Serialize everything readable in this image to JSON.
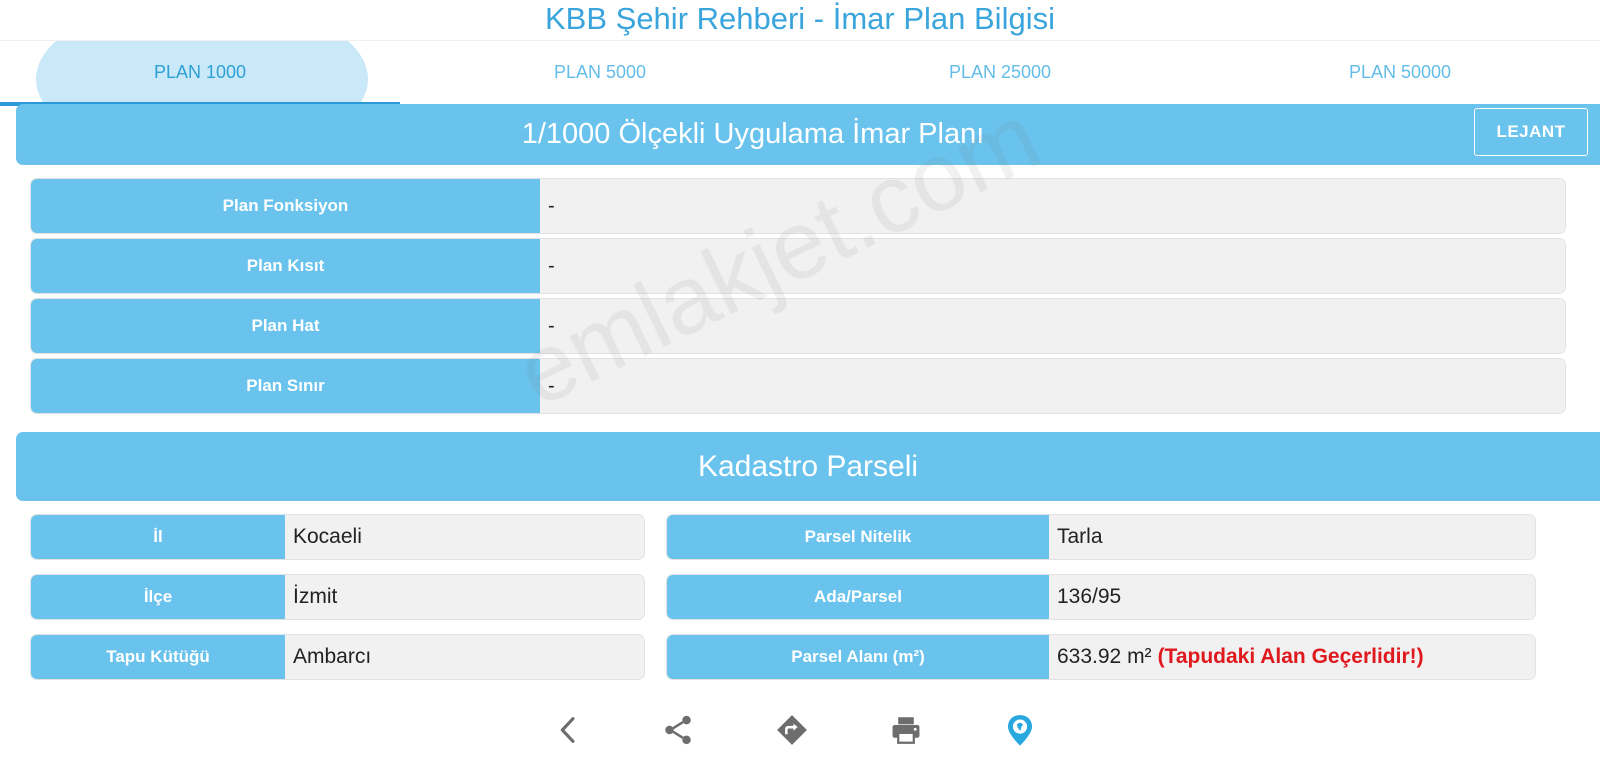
{
  "app": {
    "title": "KBB Şehir Rehberi - İmar Plan Bilgisi"
  },
  "tabs": [
    {
      "label": "PLAN 1000",
      "active": true
    },
    {
      "label": "PLAN 5000",
      "active": false
    },
    {
      "label": "PLAN 25000",
      "active": false
    },
    {
      "label": "PLAN 50000",
      "active": false
    }
  ],
  "plan_section": {
    "title": "1/1000 Ölçekli Uygulama İmar Planı",
    "legend_label": "LEJANT",
    "rows": [
      {
        "label": "Plan Fonksiyon",
        "value": "-"
      },
      {
        "label": "Plan Kısıt",
        "value": "-"
      },
      {
        "label": "Plan Hat",
        "value": "-"
      },
      {
        "label": "Plan Sınır",
        "value": "-"
      }
    ]
  },
  "kadastro_section": {
    "title": "Kadastro Parseli",
    "left": [
      {
        "label": "İl",
        "value": "Kocaeli"
      },
      {
        "label": "İlçe",
        "value": "İzmit"
      },
      {
        "label": "Tapu Kütüğü",
        "value": "Ambarcı"
      }
    ],
    "right": [
      {
        "label": "Parsel Nitelik",
        "value": "Tarla"
      },
      {
        "label": "Ada/Parsel",
        "value": "136/95"
      },
      {
        "label": "Parsel Alanı (m²)",
        "value": "633.92 m²",
        "note": "(Tapudaki Alan Geçerlidir!)"
      }
    ]
  },
  "watermark": "emlakjet.com",
  "toolbar_icons": [
    "chevron-left-icon",
    "share-icon",
    "directions-icon",
    "print-icon",
    "map-pin-icon"
  ],
  "colors": {
    "accent": "#6ac3ed",
    "title": "#3aa5dc",
    "tab_indicator": "#2a9ad6",
    "warning": "#e0191e",
    "icon": "#6d6d6d",
    "brand_icon": "#29a8e0"
  }
}
